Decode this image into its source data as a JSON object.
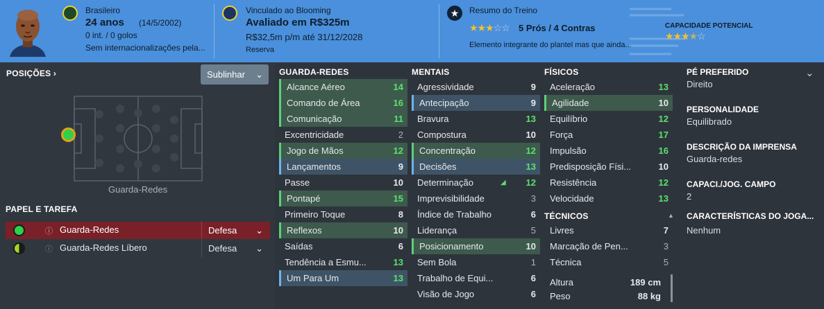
{
  "header": {
    "nationality": "Brasileiro",
    "age": "24 anos",
    "dob": "(14/5/2002)",
    "intl": "0 int. / 0 golos",
    "intl_note": "Sem internacionalizações pela...",
    "contract_label": "Vinculado ao Blooming",
    "value": "Avaliado em R$325m",
    "wage": "R$32,5m p/m até 31/12/2028",
    "squad_status": "Reserva",
    "training_label": "Resumo do Treino",
    "training_stars": 3,
    "pros_cons": "5 Prós / 4 Contras",
    "training_note": "Elemento integrante do plantel mas que ainda...",
    "potential_label": "CAPACIDADE POTENCIAL",
    "potential_stars": 3.5
  },
  "left": {
    "positions_title": "POSIÇÕES ›",
    "highlight_button": "Sublinhar",
    "position_name": "Guarda-Redes",
    "role_title": "PAPEL E TAREFA",
    "roles": [
      {
        "name": "Guarda-Redes",
        "duty": "Defesa"
      },
      {
        "name": "Guarda-Redes Líbero",
        "duty": "Defesa"
      }
    ]
  },
  "gk": {
    "title": "GUARDA-REDES",
    "attrs": [
      {
        "name": "Alcance Aéreo",
        "value": "14"
      },
      {
        "name": "Comando de Área",
        "value": "16"
      },
      {
        "name": "Comunicação",
        "value": "11"
      },
      {
        "name": "Excentricidade",
        "value": "2"
      },
      {
        "name": "Jogo de Mãos",
        "value": "12"
      },
      {
        "name": "Lançamentos",
        "value": "9"
      },
      {
        "name": "Passe",
        "value": "10"
      },
      {
        "name": "Pontapé",
        "value": "15"
      },
      {
        "name": "Primeiro Toque",
        "value": "8"
      },
      {
        "name": "Reflexos",
        "value": "10"
      },
      {
        "name": "Saídas",
        "value": "6"
      },
      {
        "name": "Tendência a Esmu...",
        "value": "13"
      },
      {
        "name": "Um Para Um",
        "value": "13"
      }
    ]
  },
  "mental": {
    "title": "MENTAIS",
    "attrs": [
      {
        "name": "Agressividade",
        "value": "9"
      },
      {
        "name": "Antecipação",
        "value": "9"
      },
      {
        "name": "Bravura",
        "value": "13"
      },
      {
        "name": "Compostura",
        "value": "10"
      },
      {
        "name": "Concentração",
        "value": "12"
      },
      {
        "name": "Decisões",
        "value": "13"
      },
      {
        "name": "Determinação",
        "value": "12"
      },
      {
        "name": "Imprevisibilidade",
        "value": "3"
      },
      {
        "name": "Índice de Trabalho",
        "value": "6"
      },
      {
        "name": "Liderança",
        "value": "5"
      },
      {
        "name": "Posicionamento",
        "value": "10"
      },
      {
        "name": "Sem Bola",
        "value": "1"
      },
      {
        "name": "Trabalho de Equi...",
        "value": "6"
      },
      {
        "name": "Visão de Jogo",
        "value": "6"
      }
    ]
  },
  "physical": {
    "title": "FÍSICOS",
    "attrs": [
      {
        "name": "Aceleração",
        "value": "13"
      },
      {
        "name": "Agilidade",
        "value": "10"
      },
      {
        "name": "Equilíbrio",
        "value": "12"
      },
      {
        "name": "Força",
        "value": "17"
      },
      {
        "name": "Impulsão",
        "value": "16"
      },
      {
        "name": "Predisposição Físi...",
        "value": "10"
      },
      {
        "name": "Resistência",
        "value": "12"
      },
      {
        "name": "Velocidade",
        "value": "13"
      }
    ],
    "tech_title": "TÉCNICOS",
    "tech": [
      {
        "name": "Livres",
        "value": "7"
      },
      {
        "name": "Marcação de Pen...",
        "value": "3"
      },
      {
        "name": "Técnica",
        "value": "5"
      }
    ],
    "height_label": "Altura",
    "height": "189 cm",
    "weight_label": "Peso",
    "weight": "88 kg"
  },
  "info": {
    "foot_label": "PÉ PREFERIDO",
    "foot": "Direito",
    "personality_label": "PERSONALIDADE",
    "personality": "Equilibrado",
    "media_label": "DESCRIÇÃO DA IMPRENSA",
    "media": "Guarda-redes",
    "field_label": "CAPACI./JOG. CAMPO",
    "field": "2",
    "traits_label": "CARACTERÍSTICAS DO JOGA...",
    "traits": "Nenhum"
  },
  "colors": {
    "header_bg": "#4a90dc",
    "green": "#5de06f",
    "highlight_green": "#3d5a4c",
    "highlight_blue": "#3e5466",
    "role_selected": "#7a2028"
  }
}
